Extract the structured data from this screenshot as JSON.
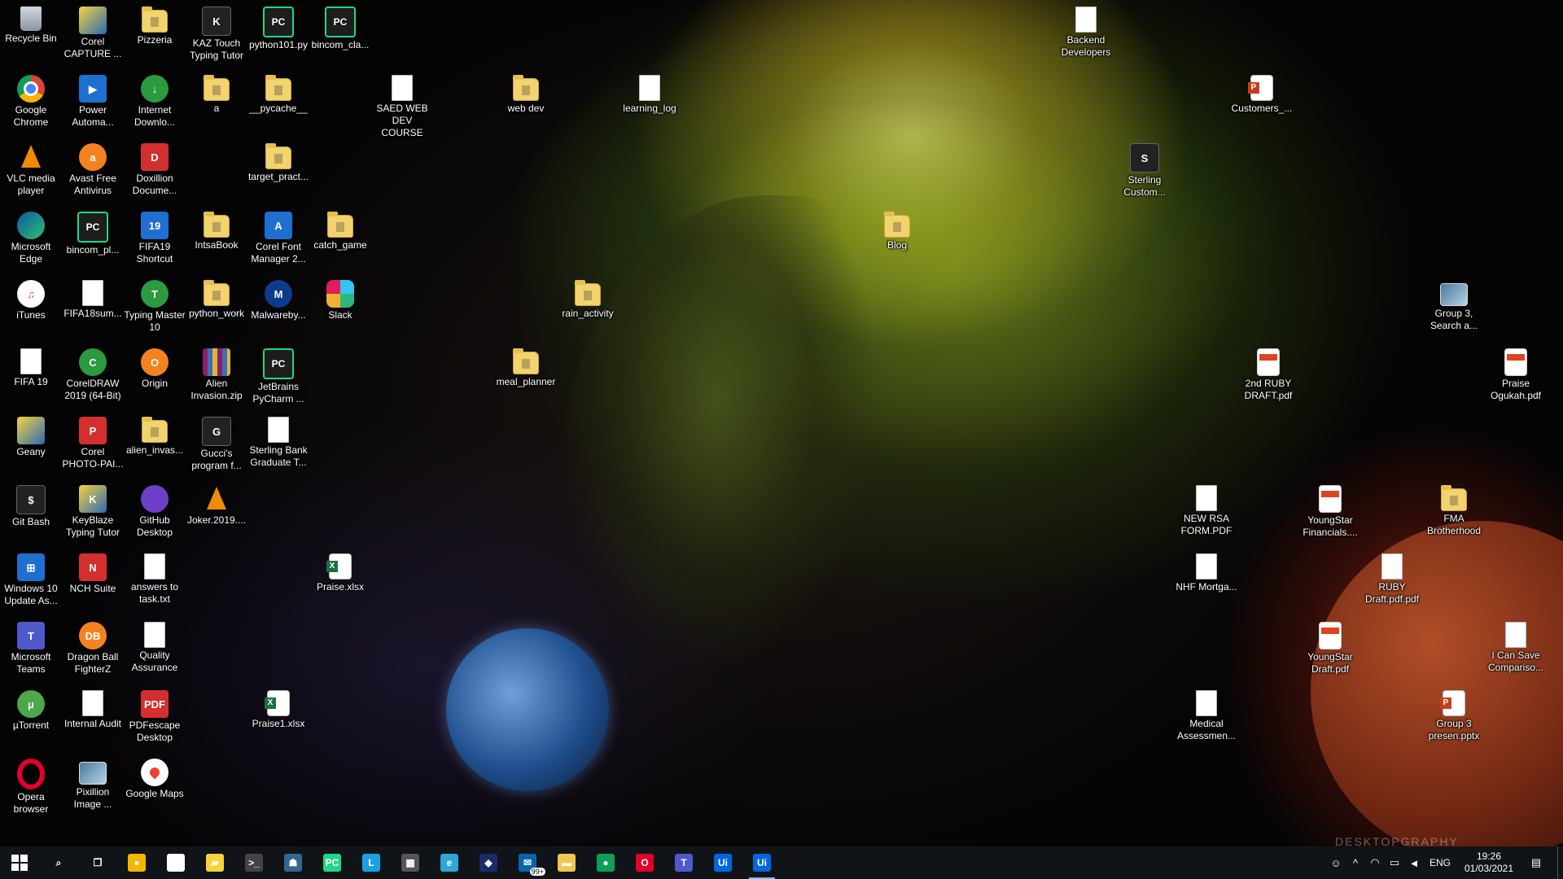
{
  "desktop": {
    "wallpaper_watermark": "DESKTOPGRAPHY",
    "icons": [
      {
        "label": "Recycle Bin",
        "icon": "recycle-bin-icon",
        "style": "bin",
        "glyph": ""
      },
      {
        "label": "Corel CAPTURE ...",
        "icon": "corel-capture-icon",
        "style": "yellowblue",
        "glyph": ""
      },
      {
        "label": "Pizzeria",
        "icon": "folder-icon",
        "style": "folder",
        "glyph": ""
      },
      {
        "label": "KAZ Touch Typing Tutor",
        "icon": "kaz-typing-icon",
        "style": "dark",
        "glyph": "K"
      },
      {
        "label": "python101.py",
        "icon": "pycharm-file-icon",
        "style": "pc",
        "glyph": "PC"
      },
      {
        "label": "bincom_cla...",
        "icon": "pycharm-file-icon",
        "style": "pc",
        "glyph": "PC"
      },
      {
        "label": "Backend Developers",
        "icon": "file-icon",
        "style": "file",
        "glyph": ""
      },
      {
        "label": "Google Chrome",
        "icon": "chrome-icon",
        "style": "chrome",
        "glyph": ""
      },
      {
        "label": "Power Automa...",
        "icon": "power-automate-icon",
        "style": "blue",
        "glyph": "▶"
      },
      {
        "label": "Internet Downlo...",
        "icon": "internet-download-icon",
        "style": "green",
        "glyph": "↓"
      },
      {
        "label": "a",
        "icon": "folder-icon",
        "style": "folder",
        "glyph": ""
      },
      {
        "label": "__pycache__",
        "icon": "folder-icon",
        "style": "folder",
        "glyph": ""
      },
      {
        "label": "SAED WEB DEV COURSE",
        "icon": "file-icon",
        "style": "file",
        "glyph": ""
      },
      {
        "label": "web dev",
        "icon": "folder-icon",
        "style": "folder",
        "glyph": ""
      },
      {
        "label": "learning_log",
        "icon": "file-icon",
        "style": "file",
        "glyph": ""
      },
      {
        "label": "Customers_...",
        "icon": "powerpoint-icon",
        "style": "ppt",
        "glyph": ""
      },
      {
        "label": "VLC media player",
        "icon": "vlc-icon",
        "style": "vlc",
        "glyph": ""
      },
      {
        "label": "Avast Free Antivirus",
        "icon": "avast-icon",
        "style": "orange",
        "glyph": "a"
      },
      {
        "label": "Doxillion Docume...",
        "icon": "doxillion-icon",
        "style": "red",
        "glyph": "D"
      },
      {
        "label": "target_pract...",
        "icon": "folder-icon",
        "style": "folder",
        "glyph": ""
      },
      {
        "label": "Sterling Custom...",
        "icon": "sterling-icon",
        "style": "dark",
        "glyph": "S"
      },
      {
        "label": "Microsoft Edge",
        "icon": "edge-icon",
        "style": "edge",
        "glyph": ""
      },
      {
        "label": "bincom_pl...",
        "icon": "pycharm-file-icon",
        "style": "pc",
        "glyph": "PC"
      },
      {
        "label": "FIFA19 Shortcut",
        "icon": "fifa-icon",
        "style": "blue",
        "glyph": "19"
      },
      {
        "label": "IntsaBook",
        "icon": "folder-icon",
        "style": "folder",
        "glyph": ""
      },
      {
        "label": "Corel Font Manager 2...",
        "icon": "corel-font-icon",
        "style": "blue",
        "glyph": "A"
      },
      {
        "label": "catch_game",
        "icon": "folder-icon",
        "style": "folder",
        "glyph": ""
      },
      {
        "label": "Blog",
        "icon": "folder-icon",
        "style": "folder",
        "glyph": ""
      },
      {
        "label": "iTunes",
        "icon": "itunes-icon",
        "style": "itunes",
        "glyph": "♫"
      },
      {
        "label": "FIFA18sum...",
        "icon": "file-icon",
        "style": "file",
        "glyph": ""
      },
      {
        "label": "Typing Master 10",
        "icon": "typing-master-icon",
        "style": "green",
        "glyph": "T"
      },
      {
        "label": "python_work",
        "icon": "folder-icon",
        "style": "folder",
        "glyph": ""
      },
      {
        "label": "Malwareby...",
        "icon": "malwarebytes-icon",
        "style": "malware",
        "glyph": "M"
      },
      {
        "label": "Slack",
        "icon": "slack-icon",
        "style": "slack",
        "glyph": ""
      },
      {
        "label": "rain_activity",
        "icon": "folder-icon",
        "style": "folder",
        "glyph": ""
      },
      {
        "label": "Group 3, Search a...",
        "icon": "image-file-icon",
        "style": "pic",
        "glyph": ""
      },
      {
        "label": "FIFA 19",
        "icon": "file-icon",
        "style": "file",
        "glyph": ""
      },
      {
        "label": "CorelDRAW 2019 (64-Bit)",
        "icon": "coreldraw-icon",
        "style": "green",
        "glyph": "C"
      },
      {
        "label": "Origin",
        "icon": "origin-icon",
        "style": "orange",
        "glyph": "O"
      },
      {
        "label": "Alien Invasion.zip",
        "icon": "zip-icon",
        "style": "zip",
        "glyph": ""
      },
      {
        "label": "JetBrains PyCharm ...",
        "icon": "pycharm-icon",
        "style": "pc",
        "glyph": "PC"
      },
      {
        "label": "meal_planner",
        "icon": "folder-icon",
        "style": "folder",
        "glyph": ""
      },
      {
        "label": "2nd RUBY DRAFT.pdf",
        "icon": "pdf-icon",
        "style": "pdf",
        "glyph": ""
      },
      {
        "label": "Praise Ogukah.pdf",
        "icon": "pdf-icon",
        "style": "pdf",
        "glyph": ""
      },
      {
        "label": "Geany",
        "icon": "geany-icon",
        "style": "yellowblue",
        "glyph": ""
      },
      {
        "label": "Corel PHOTO-PAI...",
        "icon": "corel-photo-icon",
        "style": "red",
        "glyph": "P"
      },
      {
        "label": "alien_invas...",
        "icon": "folder-icon",
        "style": "folder",
        "glyph": ""
      },
      {
        "label": "Gucci's program f...",
        "icon": "program-icon",
        "style": "dark",
        "glyph": "G"
      },
      {
        "label": "Sterling Bank Graduate T...",
        "icon": "file-icon",
        "style": "file",
        "glyph": ""
      },
      {
        "label": "Git Bash",
        "icon": "git-bash-icon",
        "style": "dark",
        "glyph": "$"
      },
      {
        "label": "KeyBlaze Typing Tutor",
        "icon": "keyblaze-icon",
        "style": "yellowblue",
        "glyph": "K"
      },
      {
        "label": "GitHub Desktop",
        "icon": "github-icon",
        "style": "github",
        "glyph": ""
      },
      {
        "label": "Joker.2019....",
        "icon": "vlc-icon",
        "style": "vlc",
        "glyph": ""
      },
      {
        "label": "NEW RSA FORM.PDF",
        "icon": "pdf-icon",
        "style": "file",
        "glyph": ""
      },
      {
        "label": "YoungStar Financials....",
        "icon": "pdf-icon",
        "style": "pdf",
        "glyph": ""
      },
      {
        "label": "FMA Brotherhood",
        "icon": "folder-icon",
        "style": "folder",
        "glyph": ""
      },
      {
        "label": "Windows 10 Update As...",
        "icon": "windows-update-icon",
        "style": "blue",
        "glyph": "⊞"
      },
      {
        "label": "NCH Suite",
        "icon": "nch-icon",
        "style": "red",
        "glyph": "N"
      },
      {
        "label": "answers to task.txt",
        "icon": "text-file-icon",
        "style": "file",
        "glyph": ""
      },
      {
        "label": "Praise.xlsx",
        "icon": "excel-icon",
        "style": "excel",
        "glyph": ""
      },
      {
        "label": "NHF Mortga...",
        "icon": "pdf-icon",
        "style": "file",
        "glyph": ""
      },
      {
        "label": "RUBY Draft.pdf.pdf",
        "icon": "pdf-icon",
        "style": "file",
        "glyph": ""
      },
      {
        "label": "Microsoft Teams",
        "icon": "teams-icon",
        "style": "teams",
        "glyph": "T"
      },
      {
        "label": "Dragon Ball FighterZ",
        "icon": "dragonball-icon",
        "style": "orange",
        "glyph": "DB"
      },
      {
        "label": "Quality Assurance",
        "icon": "file-icon",
        "style": "file",
        "glyph": ""
      },
      {
        "label": "YoungStar Draft.pdf",
        "icon": "pdf-icon",
        "style": "pdf",
        "glyph": ""
      },
      {
        "label": "I Can Save Compariso...",
        "icon": "image-file-icon",
        "style": "file",
        "glyph": ""
      },
      {
        "label": "µTorrent",
        "icon": "utorrent-icon",
        "style": "utorrent",
        "glyph": "µ"
      },
      {
        "label": "Internal Audit",
        "icon": "file-icon",
        "style": "file",
        "glyph": ""
      },
      {
        "label": "PDFescape Desktop",
        "icon": "pdfescape-icon",
        "style": "red",
        "glyph": "PDF"
      },
      {
        "label": "Praise1.xlsx",
        "icon": "excel-icon",
        "style": "excel",
        "glyph": ""
      },
      {
        "label": "Medical Assessmen...",
        "icon": "file-icon",
        "style": "file",
        "glyph": ""
      },
      {
        "label": "Group 3 presen.pptx",
        "icon": "powerpoint-icon",
        "style": "ppt",
        "glyph": ""
      },
      {
        "label": "Opera browser",
        "icon": "opera-icon",
        "style": "opera",
        "glyph": ""
      },
      {
        "label": "Pixillion Image ...",
        "icon": "pixillion-icon",
        "style": "pic",
        "glyph": ""
      },
      {
        "label": "Google Maps",
        "icon": "google-maps-icon",
        "style": "maps",
        "glyph": ""
      }
    ]
  },
  "taskbar": {
    "apps": [
      {
        "icon": "search-icon",
        "glyph": "⌕",
        "color": ""
      },
      {
        "icon": "task-view-icon",
        "glyph": "❐",
        "color": ""
      },
      {
        "icon": "chrome-icon",
        "glyph": "●",
        "color": "#f4b400"
      },
      {
        "icon": "store-icon",
        "glyph": "▣",
        "color": "#ffffff"
      },
      {
        "icon": "sticky-notes-icon",
        "glyph": "▰",
        "color": "#f7d23c"
      },
      {
        "icon": "terminal-icon",
        "glyph": ">_",
        "color": "#444444"
      },
      {
        "icon": "postgres-icon",
        "glyph": "☗",
        "color": "#336791"
      },
      {
        "icon": "pycharm-icon",
        "glyph": "PC",
        "color": "#21d789"
      },
      {
        "icon": "l-app-icon",
        "glyph": "L",
        "color": "#1ba1e2"
      },
      {
        "icon": "calculator-icon",
        "glyph": "▦",
        "color": "#555555"
      },
      {
        "icon": "edge-icon",
        "glyph": "e",
        "color": "#2fa5d8"
      },
      {
        "icon": "dark-app-icon",
        "glyph": "◆",
        "color": "#1b2a6b"
      },
      {
        "icon": "mail-icon",
        "glyph": "✉",
        "color": "#0a64ad",
        "badge": "99+"
      },
      {
        "icon": "file-explorer-icon",
        "glyph": "▬",
        "color": "#f3c64f"
      },
      {
        "icon": "chrome-icon",
        "glyph": "●",
        "color": "#0f9d58"
      },
      {
        "icon": "opera-icon",
        "glyph": "O",
        "color": "#e3002b"
      },
      {
        "icon": "teams-icon",
        "glyph": "T",
        "color": "#5059c9"
      },
      {
        "icon": "uipath-icon",
        "glyph": "Ui",
        "color": "#0067df"
      },
      {
        "icon": "uipath-icon",
        "glyph": "Ui",
        "color": "#0067df",
        "active": true
      }
    ],
    "tray": {
      "people": "☺",
      "chevron": "^",
      "network": "◠",
      "battery": "▭",
      "volume": "◄",
      "language": "ENG",
      "time": "19:26",
      "date": "01/03/2021",
      "notifications": "▤"
    }
  }
}
